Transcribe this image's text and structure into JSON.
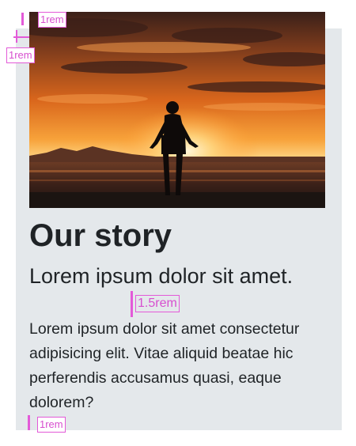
{
  "card": {
    "title": "Our story",
    "subtitle": "Lorem ipsum dolor sit amet.",
    "body": "Lorem ipsum dolor sit amet consectetur adipisicing elit. Vitae aliquid beatae hic perferendis accusamus quasi, eaque dolorem?",
    "image_description": "silhouette of a person on a beach at sunset"
  },
  "annotations": {
    "top_gap": "1rem",
    "left_gap": "1rem",
    "heading_gap": "1.5rem",
    "bottom_gap": "1rem"
  },
  "colors": {
    "card_background": "#e4e8eb",
    "text": "#1f2326",
    "annotation": "#e35ad8"
  }
}
